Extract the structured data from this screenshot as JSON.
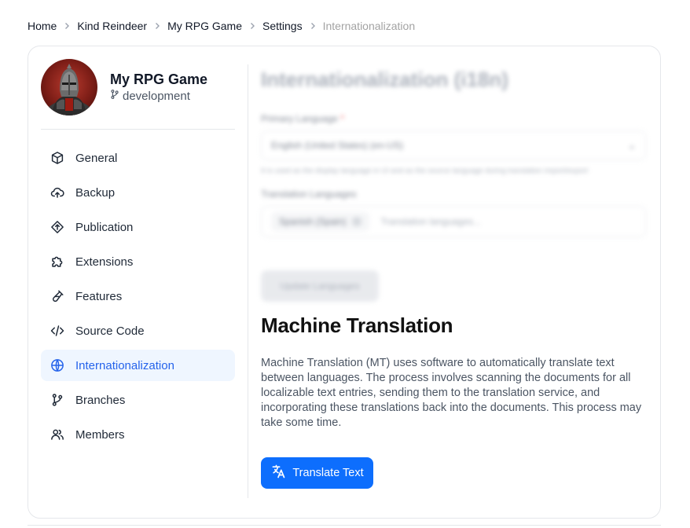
{
  "breadcrumb": [
    "Home",
    "Kind Reindeer",
    "My RPG Game",
    "Settings",
    "Internationalization"
  ],
  "project": {
    "name": "My RPG Game",
    "branch": "development",
    "avatar_icon": "knight-avatar"
  },
  "nav": [
    {
      "label": "General",
      "icon": "cube-icon",
      "active": false
    },
    {
      "label": "Backup",
      "icon": "cloud-upload-icon",
      "active": false
    },
    {
      "label": "Publication",
      "icon": "diamond-arrow-icon",
      "active": false
    },
    {
      "label": "Extensions",
      "icon": "puzzle-icon",
      "active": false
    },
    {
      "label": "Features",
      "icon": "flask-icon",
      "active": false
    },
    {
      "label": "Source Code",
      "icon": "code-icon",
      "active": false
    },
    {
      "label": "Internationalization",
      "icon": "globe-icon",
      "active": true
    },
    {
      "label": "Branches",
      "icon": "git-branch-icon",
      "active": false
    },
    {
      "label": "Members",
      "icon": "users-icon",
      "active": false
    }
  ],
  "i18n": {
    "title": "Internationalization (i18n)",
    "primary_label": "Primary Language",
    "primary_value": "English (United States) (en-US)",
    "primary_help": "It is used as the display language in UI and as the source language during translation import/export",
    "translation_label": "Translation Languages",
    "translation_chip": "Spanish (Spain)",
    "translation_placeholder": "Translation languages...",
    "update_button": "Update Languages"
  },
  "machine_translation": {
    "title": "Machine Translation",
    "description": "Machine Translation (MT) uses software to automatically translate text between languages. The process involves scanning the documents for all localizable text entries, sending them to the translation service, and incorporating these translations back into the documents. This process may take some time.",
    "button": "Translate Text"
  },
  "colors": {
    "accent": "#0d6efd",
    "active_nav_bg": "#eff6ff",
    "active_nav_text": "#2563eb"
  }
}
